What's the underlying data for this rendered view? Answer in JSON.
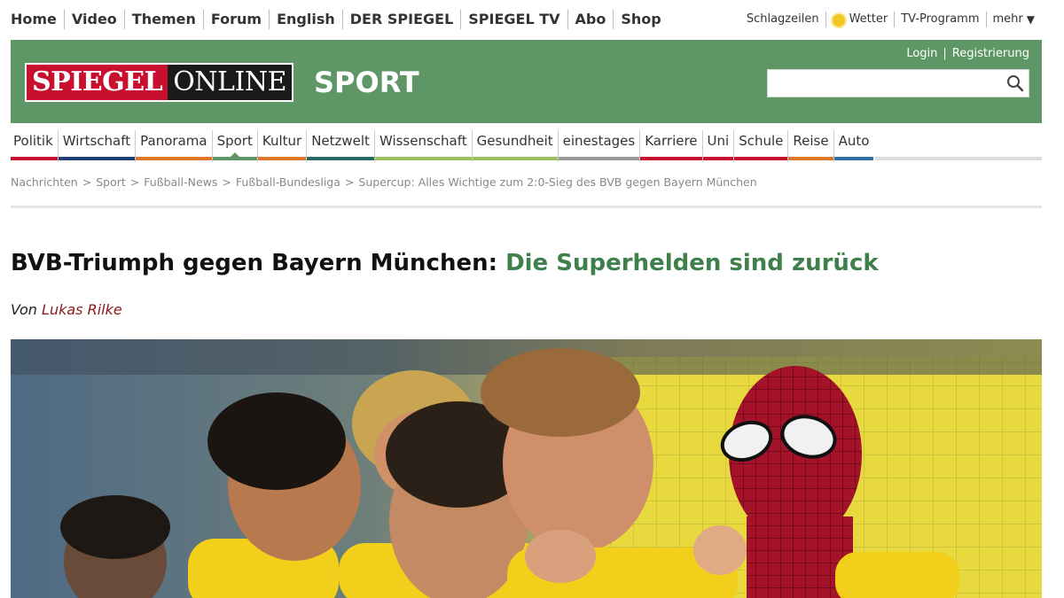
{
  "topnav": {
    "left": [
      "Home",
      "Video",
      "Themen",
      "Forum",
      "English",
      "DER SPIEGEL",
      "SPIEGEL TV",
      "Abo",
      "Shop"
    ],
    "right": [
      "Schlagzeilen",
      "Wetter",
      "TV-Programm",
      "mehr"
    ]
  },
  "header": {
    "logo_spiegel": "SPIEGEL",
    "logo_online": "ONLINE",
    "section": "SPORT",
    "login": "Login",
    "separator": "|",
    "register": "Registrierung",
    "search_placeholder": "",
    "bg_color": "#5f9666"
  },
  "sections": [
    {
      "label": "Politik",
      "color": "#c8102e"
    },
    {
      "label": "Wirtschaft",
      "color": "#1f3f78"
    },
    {
      "label": "Panorama",
      "color": "#e0762a"
    },
    {
      "label": "Sport",
      "color": "#5f9666",
      "active": true
    },
    {
      "label": "Kultur",
      "color": "#e0762a"
    },
    {
      "label": "Netzwelt",
      "color": "#2a6a66"
    },
    {
      "label": "Wissenschaft",
      "color": "#9bbf5a"
    },
    {
      "label": "Gesundheit",
      "color": "#9bbf5a"
    },
    {
      "label": "einestages",
      "color": "#999999"
    },
    {
      "label": "Karriere",
      "color": "#c8102e"
    },
    {
      "label": "Uni",
      "color": "#c8102e"
    },
    {
      "label": "Schule",
      "color": "#c8102e"
    },
    {
      "label": "Reise",
      "color": "#e0762a"
    },
    {
      "label": "Auto",
      "color": "#2f6fa8"
    }
  ],
  "breadcrumb": [
    "Nachrichten",
    "Sport",
    "Fußball-News",
    "Fußball-Bundesliga",
    "Supercup: Alles Wichtige zum 2:0-Sieg des BVB gegen Bayern München"
  ],
  "breadcrumb_sep": ">",
  "article": {
    "headline_main": "BVB-Triumph gegen Bayern München:",
    "headline_sub": "Die Superhelden sind zurück",
    "byline_prefix": "Von",
    "author": "Lukas Rilke"
  },
  "hero": {
    "description_icon": "photo-celebration"
  }
}
